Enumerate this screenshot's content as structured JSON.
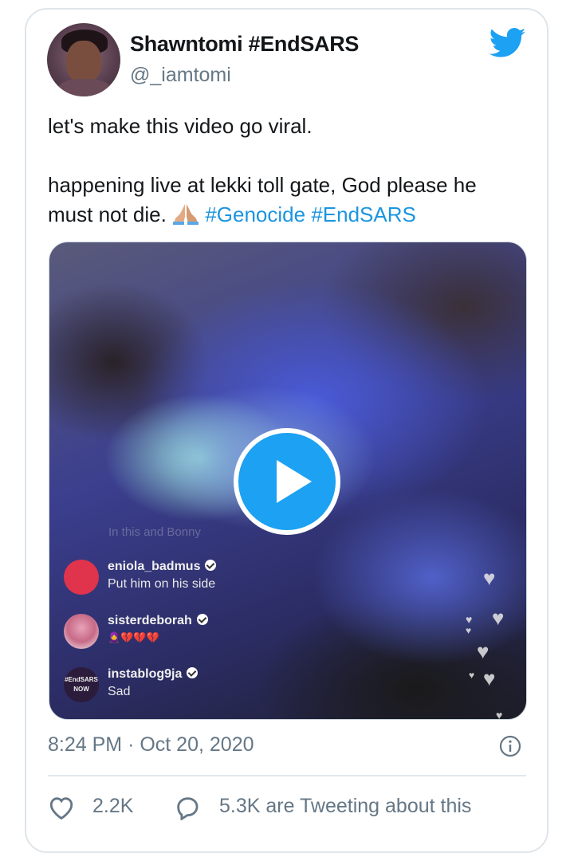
{
  "author": {
    "display_name": "Shawntomi #EndSARS",
    "handle": "@_iamtomi"
  },
  "tweet": {
    "line1": "let's make this video go viral.",
    "line2": "happening live at lekki toll gate, God please he",
    "line3": "must not die.",
    "emoji": "folded-hands",
    "hashtags": [
      "#Genocide",
      "#EndSARS"
    ]
  },
  "video": {
    "overlay_text": "In this and Bonny",
    "comments": [
      {
        "user": "eniola_badmus",
        "message": "Put him on his side",
        "verified": true
      },
      {
        "user": "sisterdeborah",
        "message": "🧕💔💔💔",
        "verified": true
      },
      {
        "user": "instablog9ja",
        "message": "Sad",
        "verified": true,
        "avatar_text": "#EndSARS NOW"
      }
    ]
  },
  "meta": {
    "time": "8:24 PM",
    "separator": "·",
    "date": "Oct 20, 2020"
  },
  "actions": {
    "likes": "2.2K",
    "tweeting": "5.3K are Tweeting about this"
  },
  "colors": {
    "accent": "#1da1f2",
    "hashtag": "#1b95e0",
    "secondary_text": "#657786"
  }
}
